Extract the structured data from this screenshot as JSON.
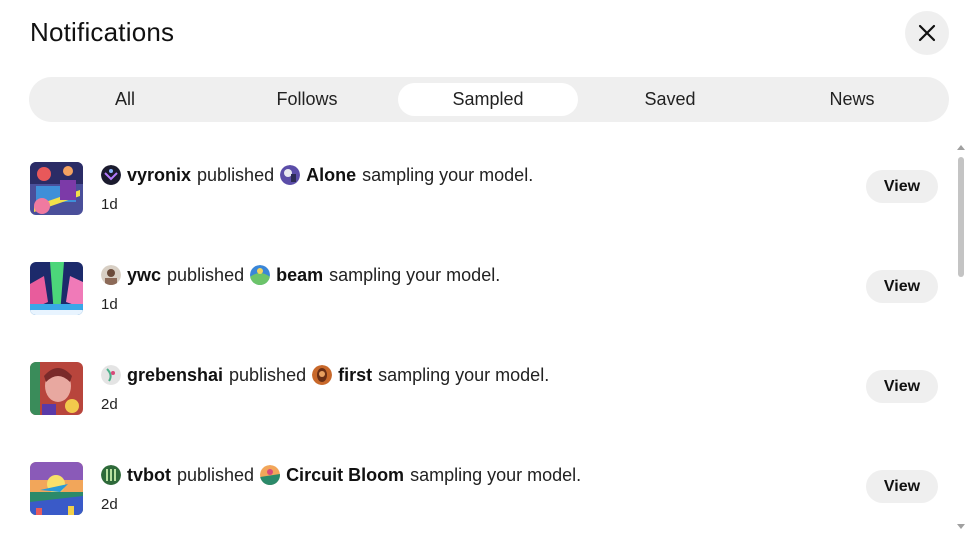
{
  "header": {
    "title": "Notifications",
    "close_icon": "close-icon"
  },
  "tabs": [
    {
      "label": "All",
      "active": false
    },
    {
      "label": "Follows",
      "active": false
    },
    {
      "label": "Sampled",
      "active": true
    },
    {
      "label": "Saved",
      "active": false
    },
    {
      "label": "News",
      "active": false
    }
  ],
  "notifications": [
    {
      "user": "vyronix",
      "verb": "published",
      "work": "Alone",
      "suffix": "sampling your model.",
      "time": "1d",
      "action": "View"
    },
    {
      "user": "ywc",
      "verb": "published",
      "work": "beam",
      "suffix": "sampling your model.",
      "time": "1d",
      "action": "View"
    },
    {
      "user": "grebenshai",
      "verb": "published",
      "work": "first",
      "suffix": "sampling your model.",
      "time": "2d",
      "action": "View"
    },
    {
      "user": "tvbot",
      "verb": "published",
      "work": "Circuit Bloom",
      "suffix": "sampling your model.",
      "time": "2d",
      "action": "View"
    }
  ],
  "colors": {
    "pill_background": "#efefef",
    "active_tab": "#ffffff",
    "text": "#111111"
  }
}
